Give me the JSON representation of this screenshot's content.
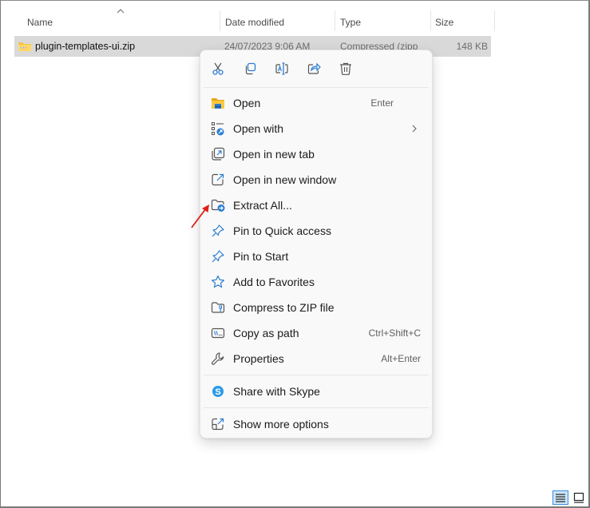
{
  "columns": {
    "name": "Name",
    "date_modified": "Date modified",
    "type": "Type",
    "size": "Size",
    "sort_indicator": "caret-up-icon"
  },
  "file": {
    "name": "plugin-templates-ui.zip",
    "date_modified": "24/07/2023 9:06 AM",
    "type": "Compressed (zipp",
    "size": "148 KB",
    "icon": "zip-folder-icon"
  },
  "context_menu": {
    "quick_actions": [
      {
        "name": "Cut",
        "icon": "scissors-icon"
      },
      {
        "name": "Copy",
        "icon": "copy-icon"
      },
      {
        "name": "Rename",
        "icon": "rename-icon"
      },
      {
        "name": "Share",
        "icon": "share-icon"
      },
      {
        "name": "Delete",
        "icon": "trash-icon"
      }
    ],
    "items": [
      {
        "label": "Open",
        "shortcut": "Enter",
        "icon": "folder-open-icon"
      },
      {
        "label": "Open with",
        "shortcut": "",
        "icon": "open-with-icon",
        "submenu": true
      },
      {
        "label": "Open in new tab",
        "shortcut": "",
        "icon": "new-tab-icon"
      },
      {
        "label": "Open in new window",
        "shortcut": "",
        "icon": "new-window-icon"
      },
      {
        "label": "Extract All...",
        "shortcut": "",
        "icon": "extract-icon"
      },
      {
        "label": "Pin to Quick access",
        "shortcut": "",
        "icon": "pin-icon"
      },
      {
        "label": "Pin to Start",
        "shortcut": "",
        "icon": "pin-icon"
      },
      {
        "label": "Add to Favorites",
        "shortcut": "",
        "icon": "star-icon"
      },
      {
        "label": "Compress to ZIP file",
        "shortcut": "",
        "icon": "zip-icon"
      },
      {
        "label": "Copy as path",
        "shortcut": "Ctrl+Shift+C",
        "icon": "copy-path-icon"
      },
      {
        "label": "Properties",
        "shortcut": "Alt+Enter",
        "icon": "wrench-icon"
      },
      {
        "label": "Share with Skype",
        "shortcut": "",
        "icon": "skype-icon"
      },
      {
        "label": "Show more options",
        "shortcut": "",
        "icon": "more-options-icon"
      }
    ]
  },
  "status_bar": {
    "views": [
      {
        "name": "Details view",
        "icon": "details-view-icon",
        "active": true
      },
      {
        "name": "Large icons view",
        "icon": "large-icons-view-icon",
        "active": false
      }
    ]
  },
  "colors": {
    "accent": "#2b7cd3",
    "selection": "#d9d9d9",
    "annotation_arrow": "#e0201b"
  }
}
